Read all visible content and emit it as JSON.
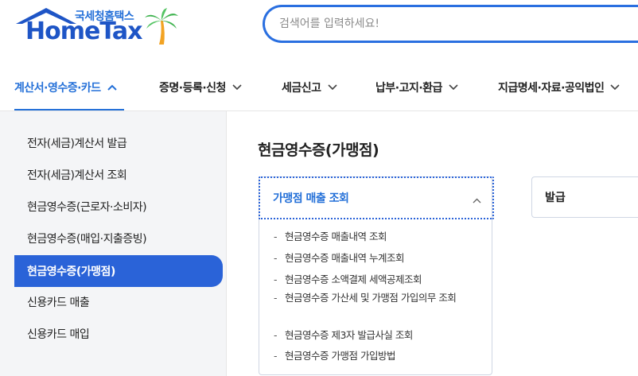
{
  "brand": {
    "subtitle": "국세청홈택스",
    "name": "HomeTax",
    "colors": {
      "primary": "#2470d8",
      "dark_blue": "#1e55c6",
      "active_menu_bg": "#2a63d8"
    }
  },
  "search": {
    "placeholder": "검색어를 입력하세요!"
  },
  "gnb": {
    "items": [
      {
        "label": "계산서·영수증·카드",
        "state": "expanded",
        "icon": "chevron-up-icon"
      },
      {
        "label": "증명·등록·신청",
        "icon": "chevron-down-icon"
      },
      {
        "label": "세금신고",
        "icon": "chevron-down-icon"
      },
      {
        "label": "납부·고지·환급",
        "icon": "chevron-down-icon"
      },
      {
        "label": "지급명세·자료·공익법인",
        "icon": "chevron-down-icon"
      }
    ]
  },
  "sidebar": {
    "items": [
      {
        "label": "전자(세금)계산서 발급"
      },
      {
        "label": "전자(세금)계산서 조회"
      },
      {
        "label": "현금영수증(근로자·소비자)"
      },
      {
        "label": "현금영수증(매입·지출증빙)"
      },
      {
        "label": "현금영수증(가맹점)",
        "active": true
      },
      {
        "label": "신용카드 매출"
      },
      {
        "label": "신용카드 매입"
      }
    ]
  },
  "main": {
    "title": "현금영수증(가맹점)",
    "accordion": {
      "label": "가맹점 매출 조회",
      "icon": "chevron-up-icon",
      "links": [
        "현금영수증 매출내역 조회",
        "현금영수증 매출내역 누계조회",
        "현금영수증 소액결제 세액공제조회",
        "현금영수증 가산세 및 가맹점 가입의무 조회",
        "현금영수증 제3자 발급사실 조회",
        "현금영수증 가맹점 가입방법"
      ]
    },
    "card2": {
      "label": "발급"
    }
  }
}
